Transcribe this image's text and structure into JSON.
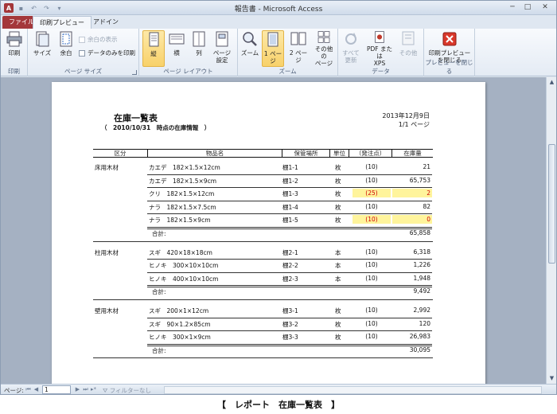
{
  "window": {
    "title": "報告書 - Microsoft Access"
  },
  "tabs": {
    "file": "ファイル",
    "print_preview": "印刷プレビュー",
    "addin": "アドイン"
  },
  "ribbon": {
    "print_group": {
      "label": "印刷",
      "print": "印刷"
    },
    "page_size_group": {
      "label": "ページ サイズ",
      "size": "サイズ",
      "margin": "余白",
      "show_margin": "余白の表示",
      "data_only": "データのみを印刷"
    },
    "layout_group": {
      "label": "ページ レイアウト",
      "portrait": "縦",
      "landscape": "横",
      "columns": "列",
      "page_setup_1": "ページ",
      "page_setup_2": "設定"
    },
    "zoom_group": {
      "label": "ズーム",
      "zoom": "ズーム",
      "one_page": "1 ページ",
      "two_pages": "2 ページ",
      "more_pages_1": "その他の",
      "more_pages_2": "ページ"
    },
    "data_group": {
      "label": "データ",
      "refresh_1": "すべて",
      "refresh_2": "更新",
      "pdf_1": "PDF または",
      "pdf_2": "XPS",
      "other": "その他"
    },
    "close_group": {
      "label": "プレビューを閉じる",
      "close_1": "印刷プレビュー",
      "close_2": "を閉じる"
    }
  },
  "report": {
    "title": "在庫一覧表",
    "subtitle": "（　2010/10/31　時点の在庫情報　）",
    "date": "2013年12月9日",
    "page": "1/1 ページ",
    "headers": [
      "区分",
      "物品名",
      "保管場所",
      "単位",
      "（発注点）",
      "在庫量"
    ],
    "sum_label": "合計:",
    "groups": [
      {
        "category": "床用木材",
        "rows": [
          {
            "name": "カエデ　182×1.5×12cm",
            "location": "棚1-1",
            "unit": "枚",
            "order_point": "(10)",
            "stock": "21",
            "alert": false
          },
          {
            "name": "カエデ　182×1.5×9cm",
            "location": "棚1-2",
            "unit": "枚",
            "order_point": "(10)",
            "stock": "65,753",
            "alert": false
          },
          {
            "name": "クリ　182×1.5×12cm",
            "location": "棚1-3",
            "unit": "枚",
            "order_point": "(25)",
            "stock": "2",
            "alert": true
          },
          {
            "name": "ナラ　182×1.5×7.5cm",
            "location": "棚1-4",
            "unit": "枚",
            "order_point": "(10)",
            "stock": "82",
            "alert": false
          },
          {
            "name": "ナラ　182×1.5×9cm",
            "location": "棚1-5",
            "unit": "枚",
            "order_point": "(10)",
            "stock": "0",
            "alert": true
          }
        ],
        "total": "65,858"
      },
      {
        "category": "柱用木材",
        "rows": [
          {
            "name": "スギ　420×18×18cm",
            "location": "棚2-1",
            "unit": "本",
            "order_point": "(10)",
            "stock": "6,318",
            "alert": false
          },
          {
            "name": "ヒノキ　300×10×10cm",
            "location": "棚2-2",
            "unit": "本",
            "order_point": "(10)",
            "stock": "1,226",
            "alert": false
          },
          {
            "name": "ヒノキ　400×10×10cm",
            "location": "棚2-3",
            "unit": "本",
            "order_point": "(10)",
            "stock": "1,948",
            "alert": false
          }
        ],
        "total": "9,492"
      },
      {
        "category": "壁用木材",
        "rows": [
          {
            "name": "スギ　200×1×12cm",
            "location": "棚3-1",
            "unit": "枚",
            "order_point": "(10)",
            "stock": "2,992",
            "alert": false
          },
          {
            "name": "スギ　90×1.2×85cm",
            "location": "棚3-2",
            "unit": "枚",
            "order_point": "(10)",
            "stock": "120",
            "alert": false
          },
          {
            "name": "ヒノキ　300×1×9cm",
            "location": "棚3-3",
            "unit": "枚",
            "order_point": "(10)",
            "stock": "26,983",
            "alert": false
          }
        ],
        "total": "30,095"
      }
    ]
  },
  "statusbar": {
    "page_label": "ページ:",
    "page_value": "1",
    "filter": "フィルターなし"
  },
  "caption": "【　レポート　在庫一覧表　】",
  "colors": {
    "accent_file_tab": "#a4373a",
    "highlight": "#fff49c",
    "alert_text": "#d00000"
  }
}
